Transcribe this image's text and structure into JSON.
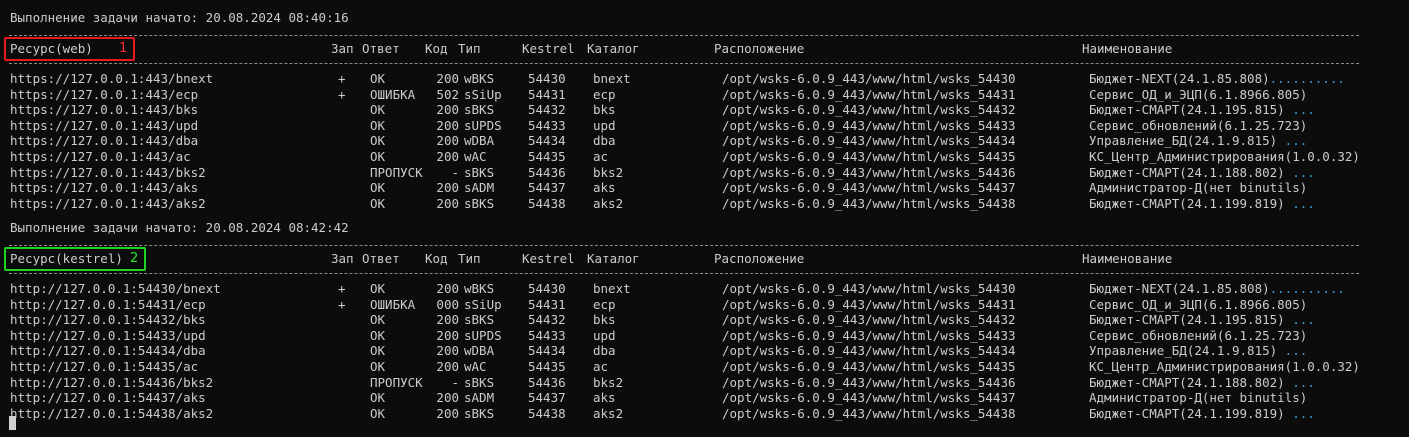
{
  "blocks": [
    {
      "title": "Выполнение задачи начато: 20.08.2024 08:40:16",
      "resource": "Ресурс(web)",
      "badge": "1",
      "badge_color": "#e8191b",
      "rows": [
        {
          "url": "https://127.0.0.1:443/bnext",
          "zap": "+",
          "resp": "OK",
          "code": "200",
          "type": "wBKS",
          "kestrel": "54430",
          "cat": "bnext",
          "loc": "/opt/wsks-6.0.9_443/www/html/wsks_54430",
          "name": "Бюджет-NEXT(24.1.85.808)",
          "dots": ".........."
        },
        {
          "url": "https://127.0.0.1:443/ecp",
          "zap": "+",
          "resp": "ОШИБКА",
          "code": "502",
          "type": "sSiUp",
          "kestrel": "54431",
          "cat": "ecp",
          "loc": "/opt/wsks-6.0.9_443/www/html/wsks_54431",
          "name": "Сервис_ОД_и_ЭЦП(6.1.8966.805)",
          "dots": ""
        },
        {
          "url": "https://127.0.0.1:443/bks",
          "zap": "",
          "resp": "OK",
          "code": "200",
          "type": "sBKS",
          "kestrel": "54432",
          "cat": "bks",
          "loc": "/opt/wsks-6.0.9_443/www/html/wsks_54432",
          "name": "Бюджет-СМАРТ(24.1.195.815)",
          "dots": " ..."
        },
        {
          "url": "https://127.0.0.1:443/upd",
          "zap": "",
          "resp": "OK",
          "code": "200",
          "type": "sUPDS",
          "kestrel": "54433",
          "cat": "upd",
          "loc": "/opt/wsks-6.0.9_443/www/html/wsks_54433",
          "name": "Сервис_обновлений(6.1.25.723)",
          "dots": ""
        },
        {
          "url": "https://127.0.0.1:443/dba",
          "zap": "",
          "resp": "OK",
          "code": "200",
          "type": "wDBA",
          "kestrel": "54434",
          "cat": "dba",
          "loc": "/opt/wsks-6.0.9_443/www/html/wsks_54434",
          "name": "Управление_БД(24.1.9.815)",
          "dots": " ..."
        },
        {
          "url": "https://127.0.0.1:443/ac",
          "zap": "",
          "resp": "OK",
          "code": "200",
          "type": "wAC",
          "kestrel": "54435",
          "cat": "ac",
          "loc": "/opt/wsks-6.0.9_443/www/html/wsks_54435",
          "name": "КС_Центр_Администрирования(1.0.0.32)",
          "dots": ""
        },
        {
          "url": "https://127.0.0.1:443/bks2",
          "zap": "",
          "resp": "ПРОПУСК",
          "code": "-",
          "type": "sBKS",
          "kestrel": "54436",
          "cat": "bks2",
          "loc": "/opt/wsks-6.0.9_443/www/html/wsks_54436",
          "name": "Бюджет-СМАРТ(24.1.188.802)",
          "dots": " ..."
        },
        {
          "url": "https://127.0.0.1:443/aks",
          "zap": "",
          "resp": "OK",
          "code": "200",
          "type": "sADM",
          "kestrel": "54437",
          "cat": "aks",
          "loc": "/opt/wsks-6.0.9_443/www/html/wsks_54437",
          "name": "Администратор-Д(нет binutils)",
          "dots": ""
        },
        {
          "url": "https://127.0.0.1:443/aks2",
          "zap": "",
          "resp": "OK",
          "code": "200",
          "type": "sBKS",
          "kestrel": "54438",
          "cat": "aks2",
          "loc": "/opt/wsks-6.0.9_443/www/html/wsks_54438",
          "name": "Бюджет-СМАРТ(24.1.199.819)",
          "dots": " ..."
        }
      ]
    },
    {
      "title": "Выполнение задачи начато: 20.08.2024 08:42:42",
      "resource": "Ресурс(kestrel)",
      "badge": "2",
      "badge_color": "#1ed41e",
      "rows": [
        {
          "url": "http://127.0.0.1:54430/bnext",
          "zap": "+",
          "resp": "OK",
          "code": "200",
          "type": "wBKS",
          "kestrel": "54430",
          "cat": "bnext",
          "loc": "/opt/wsks-6.0.9_443/www/html/wsks_54430",
          "name": "Бюджет-NEXT(24.1.85.808)",
          "dots": ".........."
        },
        {
          "url": "http://127.0.0.1:54431/ecp",
          "zap": "+",
          "resp": "ОШИБКА",
          "code": "000",
          "type": "sSiUp",
          "kestrel": "54431",
          "cat": "ecp",
          "loc": "/opt/wsks-6.0.9_443/www/html/wsks_54431",
          "name": "Сервис_ОД_и_ЭЦП(6.1.8966.805)",
          "dots": ""
        },
        {
          "url": "http://127.0.0.1:54432/bks",
          "zap": "",
          "resp": "OK",
          "code": "200",
          "type": "sBKS",
          "kestrel": "54432",
          "cat": "bks",
          "loc": "/opt/wsks-6.0.9_443/www/html/wsks_54432",
          "name": "Бюджет-СМАРТ(24.1.195.815)",
          "dots": " ..."
        },
        {
          "url": "http://127.0.0.1:54433/upd",
          "zap": "",
          "resp": "OK",
          "code": "200",
          "type": "sUPDS",
          "kestrel": "54433",
          "cat": "upd",
          "loc": "/opt/wsks-6.0.9_443/www/html/wsks_54433",
          "name": "Сервис_обновлений(6.1.25.723)",
          "dots": ""
        },
        {
          "url": "http://127.0.0.1:54434/dba",
          "zap": "",
          "resp": "OK",
          "code": "200",
          "type": "wDBA",
          "kestrel": "54434",
          "cat": "dba",
          "loc": "/opt/wsks-6.0.9_443/www/html/wsks_54434",
          "name": "Управление_БД(24.1.9.815)",
          "dots": " ..."
        },
        {
          "url": "http://127.0.0.1:54435/ac",
          "zap": "",
          "resp": "OK",
          "code": "200",
          "type": "wAC",
          "kestrel": "54435",
          "cat": "ac",
          "loc": "/opt/wsks-6.0.9_443/www/html/wsks_54435",
          "name": "КС_Центр_Администрирования(1.0.0.32)",
          "dots": ""
        },
        {
          "url": "http://127.0.0.1:54436/bks2",
          "zap": "",
          "resp": "ПРОПУСК",
          "code": "-",
          "type": "sBKS",
          "kestrel": "54436",
          "cat": "bks2",
          "loc": "/opt/wsks-6.0.9_443/www/html/wsks_54436",
          "name": "Бюджет-СМАРТ(24.1.188.802)",
          "dots": " ..."
        },
        {
          "url": "http://127.0.0.1:54437/aks",
          "zap": "",
          "resp": "OK",
          "code": "200",
          "type": "sADM",
          "kestrel": "54437",
          "cat": "aks",
          "loc": "/opt/wsks-6.0.9_443/www/html/wsks_54437",
          "name": "Администратор-Д(нет binutils)",
          "dots": ""
        },
        {
          "url": "http://127.0.0.1:54438/aks2",
          "zap": "",
          "resp": "OK",
          "code": "200",
          "type": "sBKS",
          "kestrel": "54438",
          "cat": "aks2",
          "loc": "/opt/wsks-6.0.9_443/www/html/wsks_54438",
          "name": "Бюджет-СМАРТ(24.1.199.819)",
          "dots": " ..."
        }
      ]
    }
  ],
  "headers": {
    "zap": "Зап",
    "resp": "Ответ",
    "code": "Код",
    "type": "Тип",
    "kestrel": "Kestrel",
    "cat": "Каталог",
    "loc": "Расположение",
    "name": "Наименование"
  }
}
